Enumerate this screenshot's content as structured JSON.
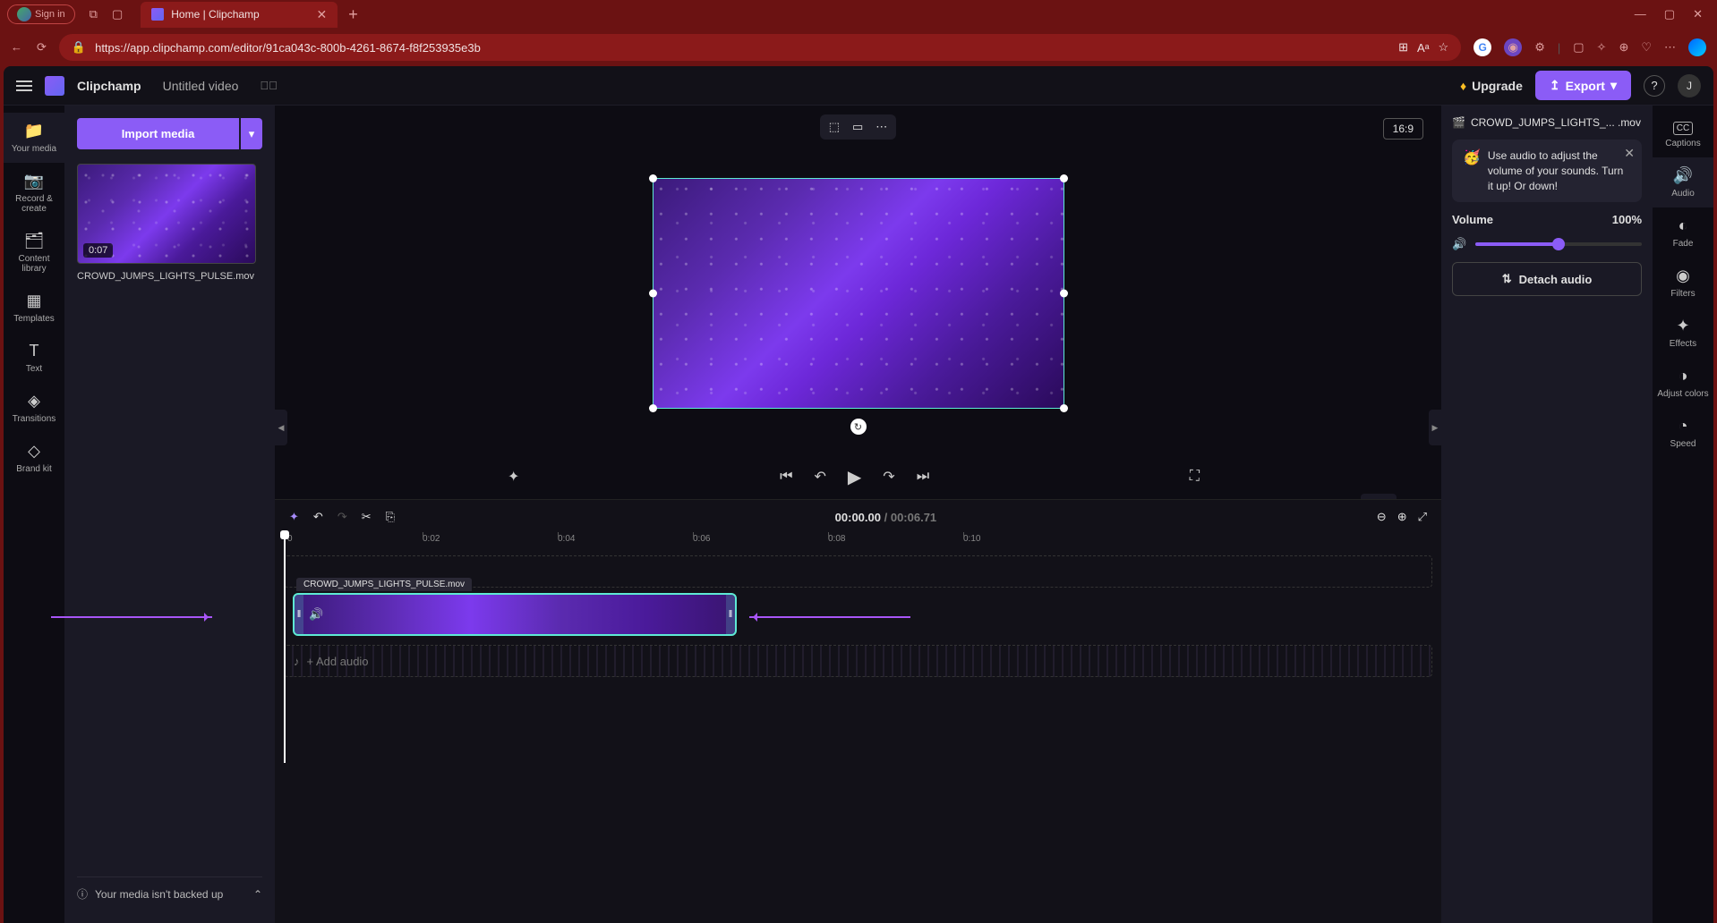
{
  "browser": {
    "signin": "Sign in",
    "tab_title": "Home | Clipchamp",
    "url": "https://app.clipchamp.com/editor/91ca043c-800b-4261-8674-f8f253935e3b"
  },
  "header": {
    "app_name": "Clipchamp",
    "project_name": "Untitled video",
    "upgrade": "Upgrade",
    "export": "Export",
    "avatar": "J"
  },
  "left_rail": [
    {
      "icon": "📁",
      "label": "Your media"
    },
    {
      "icon": "📷",
      "label": "Record & create"
    },
    {
      "icon": "🗂",
      "label": "Content library"
    },
    {
      "icon": "▦",
      "label": "Templates"
    },
    {
      "icon": "T",
      "label": "Text"
    },
    {
      "icon": "◈",
      "label": "Transitions"
    },
    {
      "icon": "◇",
      "label": "Brand kit"
    }
  ],
  "media_panel": {
    "import": "Import media",
    "thumb_duration": "0:07",
    "thumb_name": "CROWD_JUMPS_LIGHTS_PULSE.mov",
    "backup_msg": "Your media isn't backed up"
  },
  "preview": {
    "aspect": "16:9"
  },
  "playback": {
    "current": "00:00.00",
    "total": "00:06.71"
  },
  "timeline": {
    "ticks": [
      "0",
      "0:02",
      "0:04",
      "0:06",
      "0:08",
      "0:10"
    ],
    "clip_label": "CROWD_JUMPS_LIGHTS_PULSE.mov",
    "add_audio": "+ Add audio"
  },
  "right_panel": {
    "clip_name": "CROWD_JUMPS_LIGHTS_... .mov",
    "tip": "Use audio to adjust the volume of your sounds. Turn it up! Or down!",
    "volume_label": "Volume",
    "volume_value": "100%",
    "detach": "Detach audio"
  },
  "right_rail": [
    {
      "icon": "CC",
      "label": "Captions"
    },
    {
      "icon": "🔊",
      "label": "Audio"
    },
    {
      "icon": "◐",
      "label": "Fade"
    },
    {
      "icon": "◉",
      "label": "Filters"
    },
    {
      "icon": "✦",
      "label": "Effects"
    },
    {
      "icon": "◑",
      "label": "Adjust colors"
    },
    {
      "icon": "◔",
      "label": "Speed"
    }
  ]
}
